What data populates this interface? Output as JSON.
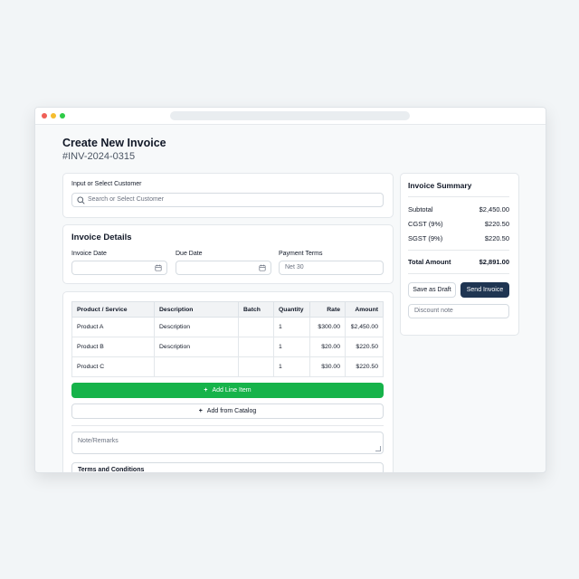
{
  "page": {
    "title": "Create New Invoice",
    "invoice_number": "#INV-2024-0315"
  },
  "customer": {
    "label": "Input or Select Customer",
    "placeholder": "Search or Select Customer"
  },
  "invoice_details": {
    "title": "Invoice Details",
    "invoice_date_label": "Invoice Date",
    "invoice_date_value": "",
    "due_date_label": "Due Date",
    "due_date_value": "",
    "payment_terms_label": "Payment Terms",
    "payment_terms_value": "Net 30"
  },
  "line_items": {
    "headers": [
      "Product / Service",
      "Description",
      "Batch",
      "Quantity",
      "Rate",
      "Amount"
    ],
    "rows": [
      {
        "product": "Product A",
        "description": "Description",
        "batch": "",
        "quantity": "1",
        "rate": "$300.00",
        "amount": "$2,450.00"
      },
      {
        "product": "Product B",
        "description": "Description",
        "batch": "",
        "quantity": "1",
        "rate": "$20.00",
        "amount": "$220.50"
      },
      {
        "product": "Product C",
        "description": "",
        "batch": "",
        "quantity": "1",
        "rate": "$30.00",
        "amount": "$220.50"
      }
    ],
    "add_line_label": "Add Line Item",
    "add_catalog_label": "Add from Catalog"
  },
  "notes": {
    "placeholder": "Note/Remarks"
  },
  "terms": {
    "label": "Terms and Conditions"
  },
  "summary": {
    "title": "Invoice Summary",
    "subtotal_label": "Subtotal",
    "subtotal_value": "$2,450.00",
    "cgst_label": "CGST (9%)",
    "cgst_value": "$220.50",
    "sgst_label": "SGST (9%)",
    "sgst_value": "$220.50",
    "total_label": "Total Amount",
    "total_value": "$2,891.00",
    "save_draft_label": "Save as Draft",
    "send_label": "Send Invoice",
    "discount_placeholder": "Discount note"
  },
  "colors": {
    "primary_green": "#16b34a",
    "send_button": "#1f3552"
  },
  "icons": [
    "search-icon",
    "calendar-icon",
    "plus-icon",
    "resize-handle-icon"
  ]
}
